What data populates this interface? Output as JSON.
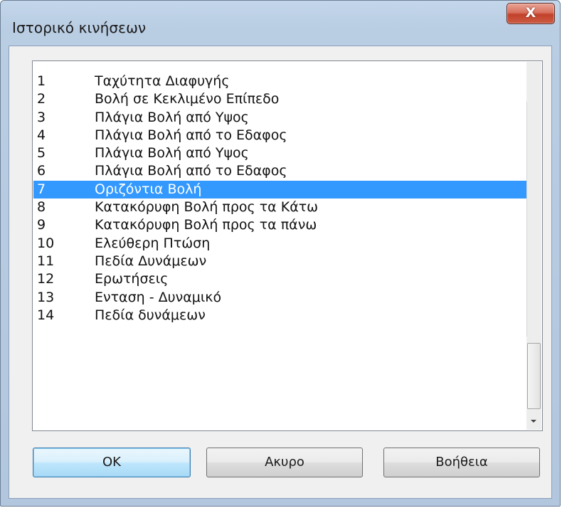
{
  "window": {
    "title": "Ιστορικό κινήσεων",
    "close_label": "X"
  },
  "list": {
    "selected_index": 6,
    "items": [
      {
        "num": "1",
        "label": "Ταχύτητα Διαφυγής"
      },
      {
        "num": "2",
        "label": "Βολή σε Κεκλιμένο Επίπεδο"
      },
      {
        "num": "3",
        "label": "Πλάγια Βολή από Υψος"
      },
      {
        "num": "4",
        "label": "Πλάγια Βολή από το Εδαφος"
      },
      {
        "num": "5",
        "label": "Πλάγια Βολή από Υψος"
      },
      {
        "num": "6",
        "label": "Πλάγια Βολή από το Εδαφος"
      },
      {
        "num": "7",
        "label": "Οριζόντια Βολή"
      },
      {
        "num": "8",
        "label": "Κατακόρυφη Βολή προς τα Κάτω"
      },
      {
        "num": "9",
        "label": "Κατακόρυφη Βολή προς τα πάνω"
      },
      {
        "num": "10",
        "label": "Ελεύθερη Πτώση"
      },
      {
        "num": "11",
        "label": "Πεδία Δυνάμεων"
      },
      {
        "num": "12",
        "label": "Ερωτήσεις"
      },
      {
        "num": "13",
        "label": "Ενταση - Δυναμικό"
      },
      {
        "num": "14",
        "label": "Πεδία δυνάμεων"
      }
    ]
  },
  "buttons": {
    "ok": "OK",
    "cancel": "Ακυρο",
    "help": "Βοήθεια"
  },
  "colors": {
    "selection": "#3399ff",
    "close_button": "#c2412b",
    "title_bar": "#b9cde3"
  },
  "icons": {
    "close": "close-icon",
    "scroll_down": "chevron-down-icon"
  }
}
